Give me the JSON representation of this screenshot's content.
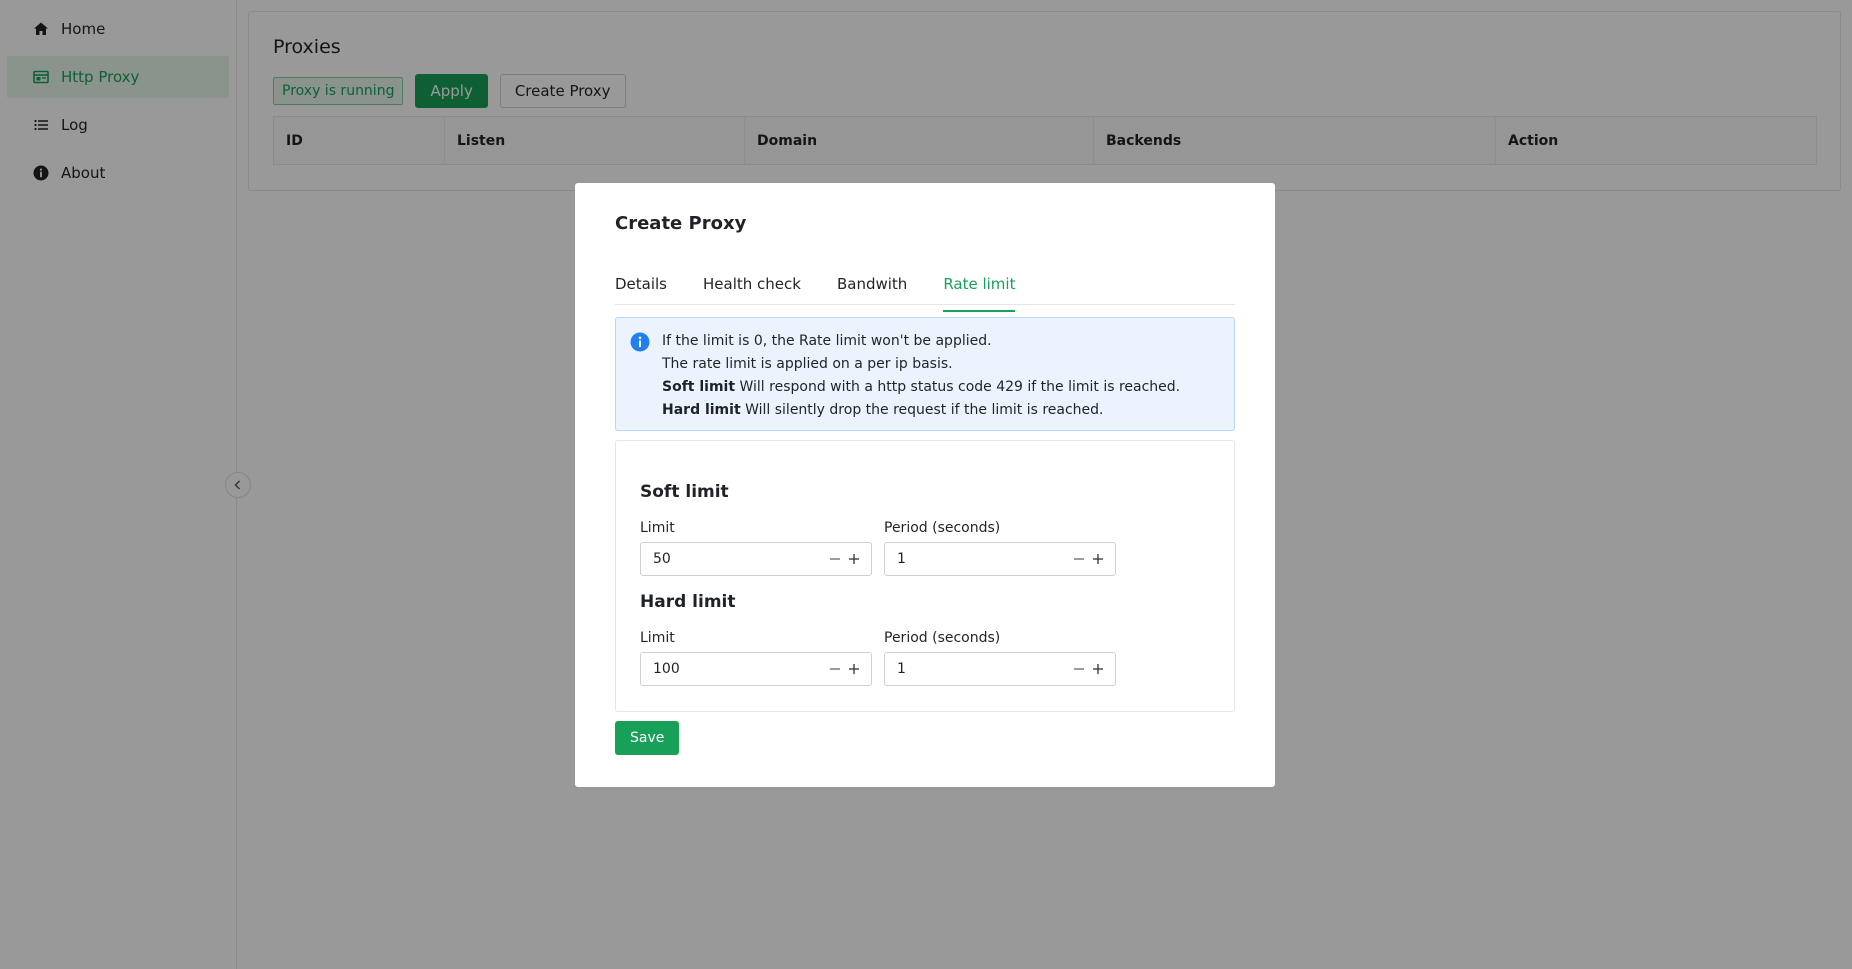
{
  "sidebar": {
    "items": [
      {
        "label": "Home",
        "icon": "home-icon",
        "active": false
      },
      {
        "label": "Http Proxy",
        "icon": "proxy-icon",
        "active": true
      },
      {
        "label": "Log",
        "icon": "list-icon",
        "active": false
      },
      {
        "label": "About",
        "icon": "info-icon",
        "active": false
      }
    ]
  },
  "main": {
    "title": "Proxies",
    "status_tag": "Proxy is running",
    "apply_label": "Apply",
    "create_label": "Create Proxy",
    "table": {
      "columns": [
        "ID",
        "Listen",
        "Domain",
        "Backends",
        "Action"
      ]
    }
  },
  "modal": {
    "title": "Create Proxy",
    "tabs": [
      "Details",
      "Health check",
      "Bandwith",
      "Rate limit"
    ],
    "active_tab": "Rate limit",
    "alert": {
      "line1": "If the limit is 0, the Rate limit won't be applied.",
      "line2": "The rate limit is applied on a per ip basis.",
      "line3_bold": "Soft limit",
      "line3_text": " Will respond with a http status code 429 if the limit is reached.",
      "line4_bold": "Hard limit",
      "line4_text": " Will silently drop the request if the limit is reached."
    },
    "soft": {
      "title": "Soft limit",
      "limit_label": "Limit",
      "limit_value": "50",
      "period_label": "Period (seconds)",
      "period_value": "1"
    },
    "hard": {
      "title": "Hard limit",
      "limit_label": "Limit",
      "limit_value": "100",
      "period_label": "Period (seconds)",
      "period_value": "1"
    },
    "save_label": "Save"
  },
  "colors": {
    "accent": "#18a058",
    "info": "#2080f0",
    "overlay": "rgba(0,0,0,0.4)"
  }
}
